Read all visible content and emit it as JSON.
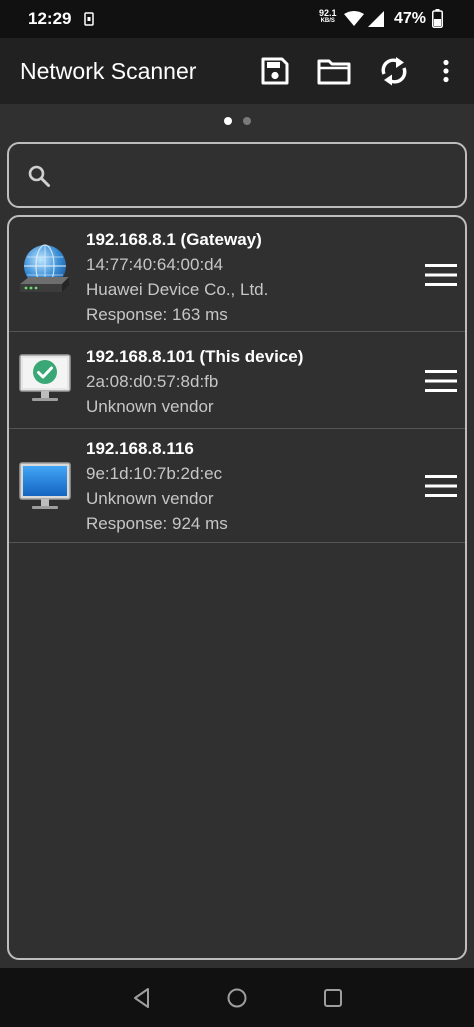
{
  "status_bar": {
    "time": "12:29",
    "net_speed": "92.1",
    "net_speed_unit": "KB/S",
    "battery": "47%"
  },
  "app_bar": {
    "title": "Network Scanner",
    "actions": [
      "save-icon",
      "folder-icon",
      "refresh-icon",
      "more-vert-icon"
    ]
  },
  "pager": {
    "pages": 2,
    "current": 1
  },
  "search": {
    "value": "",
    "placeholder": ""
  },
  "devices": [
    {
      "ip": "192.168.8.1 (Gateway)",
      "lines": [
        "14:77:40:64:00:d4",
        "Huawei Device Co., Ltd.",
        "Response: 163 ms"
      ],
      "icon": "router-globe-icon"
    },
    {
      "ip": "192.168.8.101 (This device)",
      "lines": [
        "2a:08:d0:57:8d:fb",
        "Unknown vendor"
      ],
      "icon": "monitor-check-icon"
    },
    {
      "ip": "192.168.8.116",
      "lines": [
        "9e:1d:10:7b:2d:ec",
        "Unknown vendor",
        "Response: 924 ms"
      ],
      "icon": "monitor-icon"
    }
  ],
  "colors": {
    "background": "#303030",
    "app_bar": "#212121",
    "check_green": "#3aa876",
    "monitor_blue": "#1e88e5"
  }
}
